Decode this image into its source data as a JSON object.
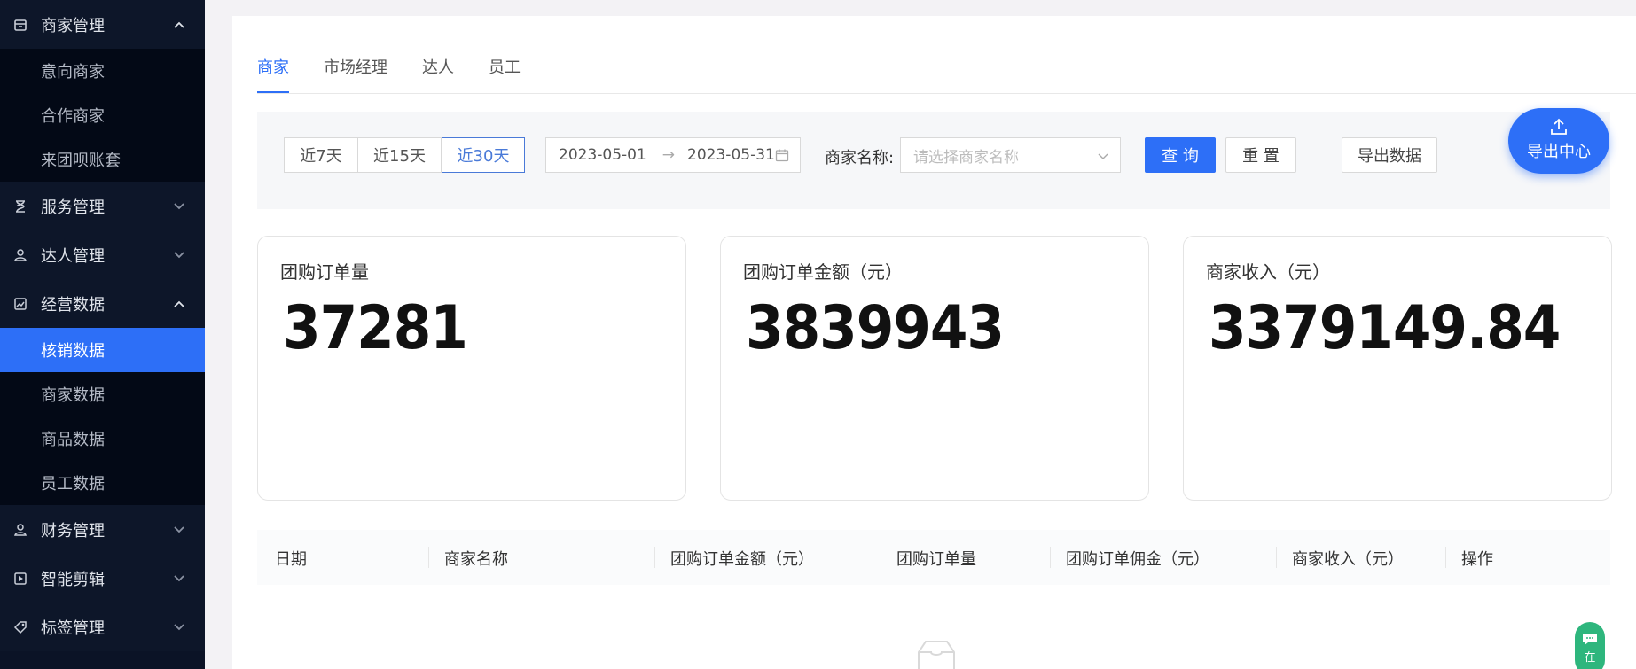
{
  "sidebar": {
    "groups": [
      {
        "label": "商家管理",
        "icon": "store-icon",
        "expanded": true,
        "items": [
          "意向商家",
          "合作商家",
          "来团呗账套"
        ]
      },
      {
        "label": "服务管理",
        "icon": "hourglass-icon",
        "expanded": false
      },
      {
        "label": "达人管理",
        "icon": "person-icon",
        "expanded": false
      },
      {
        "label": "经营数据",
        "icon": "chart-icon",
        "expanded": true,
        "items": [
          "核销数据",
          "商家数据",
          "商品数据",
          "员工数据"
        ],
        "active_item": "核销数据"
      },
      {
        "label": "财务管理",
        "icon": "person-icon",
        "expanded": false
      },
      {
        "label": "智能剪辑",
        "icon": "clip-icon",
        "expanded": false
      },
      {
        "label": "标签管理",
        "icon": "tag-icon",
        "expanded": false
      }
    ]
  },
  "tabs": [
    "商家",
    "市场经理",
    "达人",
    "员工"
  ],
  "active_tab": "商家",
  "filter": {
    "ranges": [
      "近7天",
      "近15天",
      "近30天"
    ],
    "active_range": "近30天",
    "date_start": "2023-05-01",
    "date_end": "2023-05-31",
    "merchant_label": "商家名称:",
    "merchant_placeholder": "请选择商家名称",
    "query_label": "查 询",
    "reset_label": "重 置",
    "export_label": "导出数据"
  },
  "fab_label": "导出中心",
  "cards": [
    {
      "title": "团购订单量",
      "value": "37281"
    },
    {
      "title": "团购订单金额（元）",
      "value": "3839943"
    },
    {
      "title": "商家收入（元）",
      "value": "3379149.84"
    }
  ],
  "table": {
    "columns": [
      "日期",
      "商家名称",
      "团购订单金额（元）",
      "团购订单量",
      "团购订单佣金（元）",
      "商家收入（元）",
      "操作"
    ]
  },
  "chat_label": "在",
  "colors": {
    "accent": "#2d6ff7",
    "sidebar": "#0b1326",
    "chat": "#2eb67d"
  }
}
